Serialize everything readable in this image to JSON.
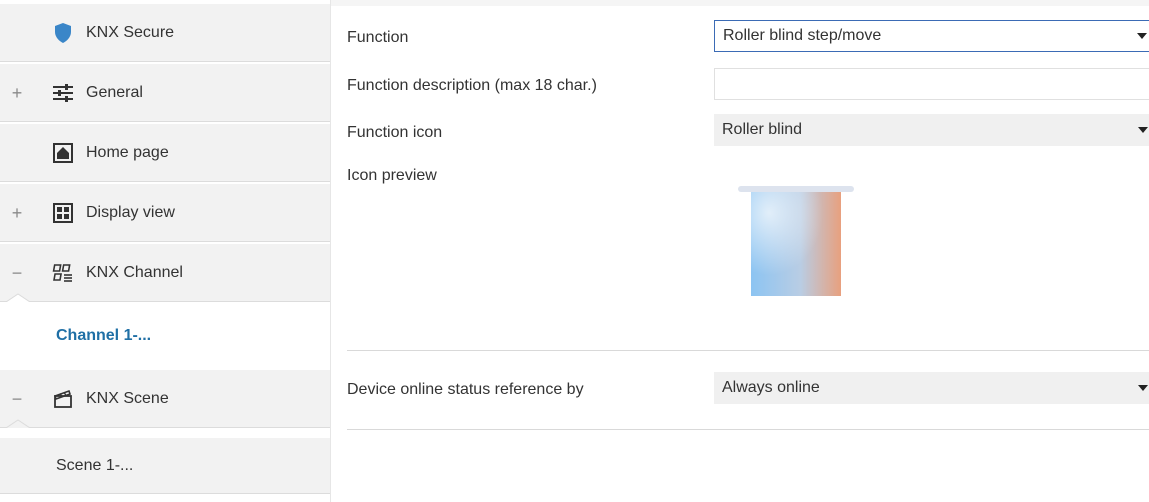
{
  "sidebar": {
    "items": [
      {
        "label": "KNX Secure",
        "icon": "shield-icon",
        "toggle": ""
      },
      {
        "label": "General",
        "icon": "sliders-icon",
        "toggle": "+"
      },
      {
        "label": "Home page",
        "icon": "home-icon",
        "toggle": ""
      },
      {
        "label": "Display view",
        "icon": "grid-icon",
        "toggle": "+"
      },
      {
        "label": "KNX Channel",
        "icon": "channel-icon",
        "toggle": "−"
      },
      {
        "label": "KNX Scene",
        "icon": "scene-icon",
        "toggle": "−"
      }
    ],
    "channel_sub": "Channel 1-...",
    "scene_sub": "Scene 1-..."
  },
  "form": {
    "function_label": "Function",
    "function_value": "Roller blind step/move",
    "description_label": "Function description (max 18 char.)",
    "description_value": "",
    "icon_label": "Function icon",
    "icon_value": "Roller blind",
    "preview_label": "Icon preview",
    "online_label": "Device online status reference by",
    "online_value": "Always online"
  },
  "colors": {
    "accent": "#1f6fa5",
    "shield": "#3a86c8",
    "sidebar_bg": "#f2f2f2",
    "focus_border": "#3b6bb5"
  }
}
